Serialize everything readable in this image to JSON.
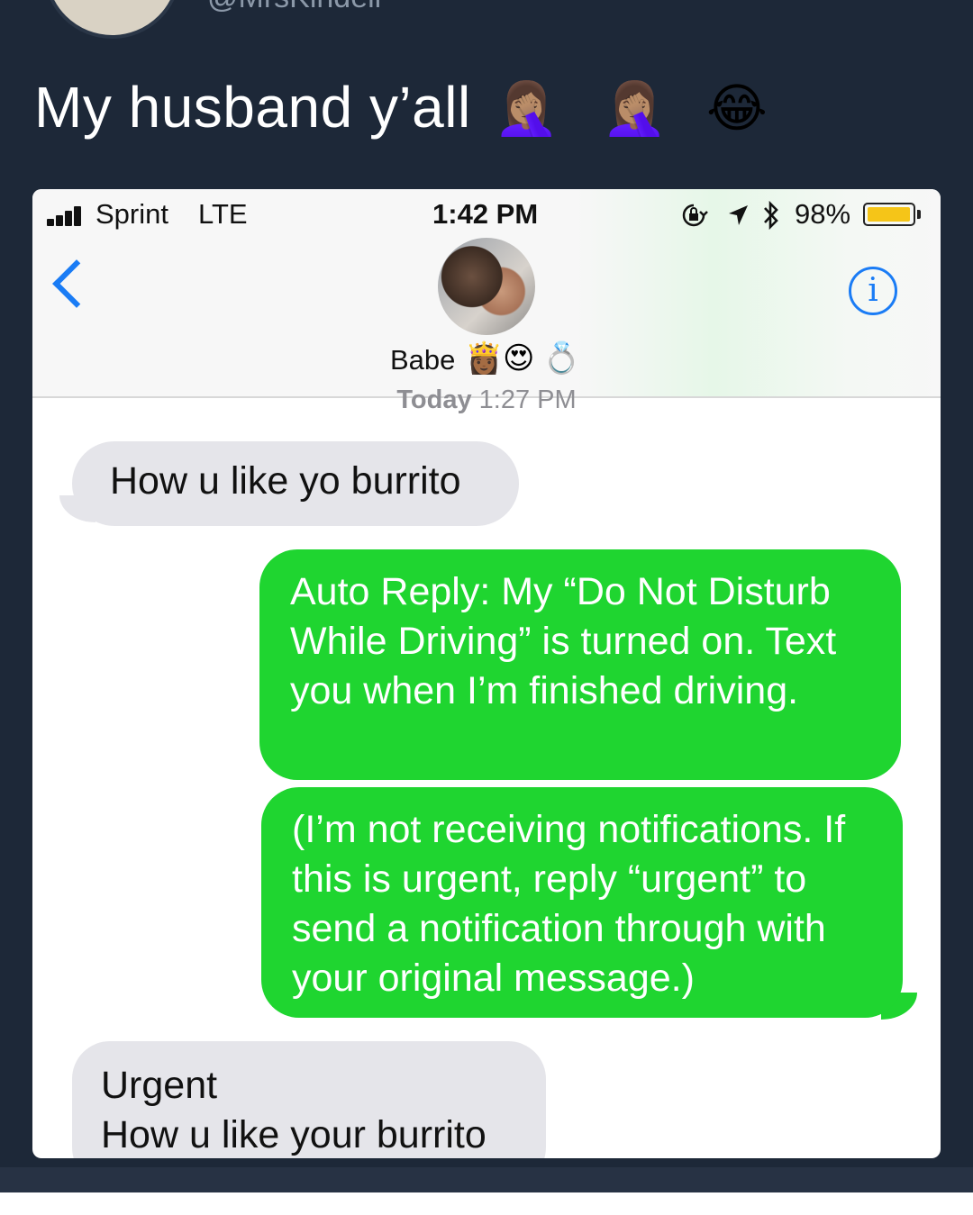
{
  "tweet": {
    "handle": "@MrsKindell",
    "text": "My husband y’all",
    "emojis": [
      "🤦🏽‍♀️",
      "🤦🏽‍♀️",
      "😂"
    ]
  },
  "status_bar": {
    "carrier": "Sprint",
    "network": "LTE",
    "time": "1:42 PM",
    "battery": "98%",
    "battery_level": 0.98,
    "icons": [
      "lock-rotation-icon",
      "location-arrow-icon",
      "bluetooth-icon"
    ]
  },
  "conversation": {
    "contact_name": "Babe",
    "contact_emojis": [
      "👸🏾",
      "😍",
      "💍"
    ],
    "timestamp_day": "Today",
    "timestamp_time": "1:27 PM",
    "messages": [
      {
        "direction": "incoming",
        "text": "How u like yo burrito"
      },
      {
        "direction": "outgoing",
        "text": "Auto Reply: My “Do Not Disturb While Driving” is turned on. Text you when I’m finished driving."
      },
      {
        "direction": "outgoing",
        "text": "(I’m not receiving notifications. If this is urgent, reply “urgent” to send a notification through with your original message.)"
      },
      {
        "direction": "incoming",
        "line1": "Urgent",
        "line2": "How u like your burrito"
      }
    ]
  },
  "colors": {
    "background": "#1d2838",
    "imessage_blue": "#1a7cf5",
    "sms_green": "#1fd530",
    "incoming_gray": "#e5e5ea"
  }
}
